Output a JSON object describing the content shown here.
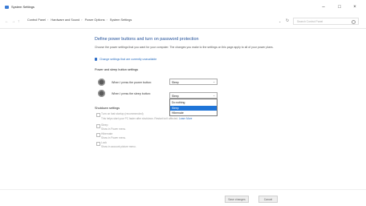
{
  "window": {
    "title": "System Settings"
  },
  "address": {
    "crumbs": [
      "Control Panel",
      "Hardware and Sound",
      "Power Options",
      "System Settings"
    ],
    "search_placeholder": "Search Control Panel"
  },
  "content": {
    "heading": "Define power buttons and turn on password protection",
    "description": "Choose the power settings that you want for your computer. The changes you make to the settings on this page apply to all of your power plans.",
    "admin_link": "Change settings that are currently unavailable",
    "section_title": "Power and sleep button settings",
    "power_button_label": "When I press the power button:",
    "power_button_value": "Sleep",
    "sleep_button_label": "When I press the sleep button:",
    "sleep_button_value": "Sleep",
    "sleep_options": [
      "Do nothing",
      "Sleep",
      "Hibernate"
    ],
    "sleep_selected_index": 1,
    "shutdown_title": "Shutdown settings",
    "fast_startup_label": "Turn on fast startup (recommended)",
    "fast_startup_desc": "This helps start your PC faster after shutdown. Restart isn't affected.",
    "learn_more": "Learn More",
    "sleep_label": "Sleep",
    "sleep_desc": "Show in Power menu.",
    "hibernate_label": "Hibernate",
    "hibernate_desc": "Show in Power menu.",
    "lock_label": "Lock",
    "lock_desc": "Show in account picture menu."
  },
  "footer": {
    "save_label": "Save changes",
    "cancel_label": "Cancel"
  }
}
